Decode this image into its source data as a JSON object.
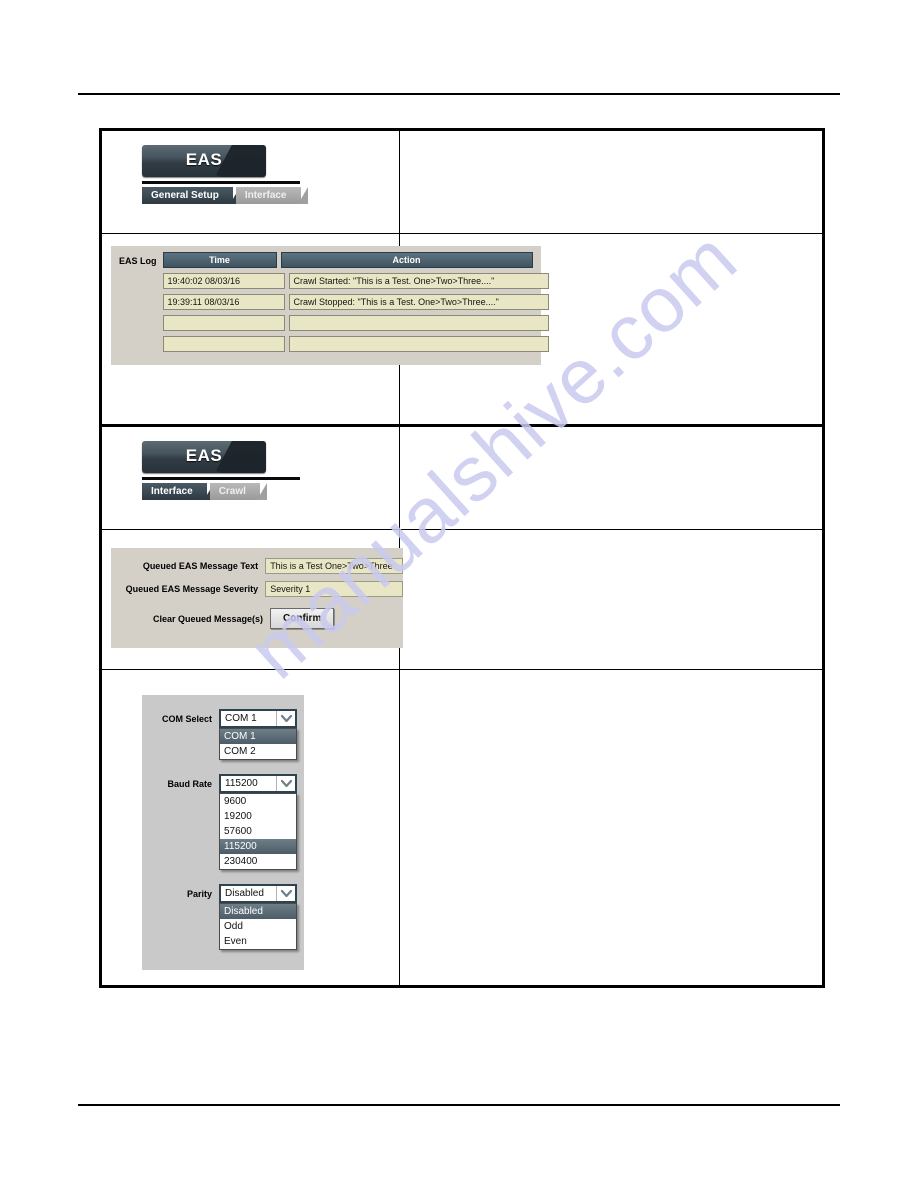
{
  "watermark": {
    "text": "manualshive.com"
  },
  "sections": [
    {
      "name": "eas-general-setup",
      "header": {
        "banner_label": "EAS",
        "tabs": [
          {
            "label": "General Setup",
            "state": "active"
          },
          {
            "label": "Interface",
            "state": "inactive"
          }
        ]
      },
      "eas_log": {
        "label": "EAS Log",
        "columns": [
          "Time",
          "Action"
        ],
        "rows": [
          {
            "time": "19:40:02 08/03/16",
            "action": "Crawl Started: \"This is a Test. One>Two>Three....\""
          },
          {
            "time": "19:39:11 08/03/16",
            "action": "Crawl Stopped: \"This is a Test. One>Two>Three....\""
          },
          {
            "time": "",
            "action": ""
          },
          {
            "time": "",
            "action": ""
          }
        ]
      }
    },
    {
      "name": "eas-interface",
      "header": {
        "banner_label": "EAS",
        "tabs": [
          {
            "label": "Interface",
            "state": "active"
          },
          {
            "label": "Crawl",
            "state": "inactive"
          }
        ]
      },
      "queued": {
        "fields": [
          {
            "label": "Queued EAS Message Text",
            "value": "This is a Test One>Two>Three"
          },
          {
            "label": "Queued EAS Message Severity",
            "value": "Severity 1"
          }
        ],
        "action": {
          "label": "Clear Queued Message(s)",
          "button": "Confirm"
        }
      },
      "serial": {
        "selects": [
          {
            "label": "COM Select",
            "value": "COM 1",
            "options": [
              "COM 1",
              "COM 2"
            ],
            "selected_index": 0
          },
          {
            "label": "Baud Rate",
            "value": "115200",
            "options": [
              "9600",
              "19200",
              "57600",
              "115200",
              "230400"
            ],
            "selected_index": 3
          },
          {
            "label": "Parity",
            "value": "Disabled",
            "options": [
              "Disabled",
              "Odd",
              "Even"
            ],
            "selected_index": 0
          }
        ]
      }
    }
  ]
}
